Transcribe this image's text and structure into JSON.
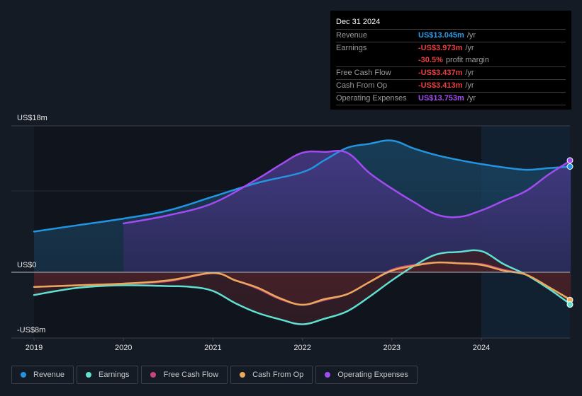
{
  "tooltip": {
    "date": "Dec 31 2024",
    "rows": [
      {
        "label": "Revenue",
        "value": "US$13.045m",
        "unit": "/yr",
        "color": "#2d9be8"
      },
      {
        "label": "Earnings",
        "value": "-US$3.973m",
        "unit": "/yr",
        "color": "#e84040"
      },
      {
        "label": "",
        "value": "-30.5%",
        "unit": "profit margin",
        "color": "#e84040"
      },
      {
        "label": "Free Cash Flow",
        "value": "-US$3.437m",
        "unit": "/yr",
        "color": "#e84040"
      },
      {
        "label": "Cash From Op",
        "value": "-US$3.413m",
        "unit": "/yr",
        "color": "#e84040"
      },
      {
        "label": "Operating Expenses",
        "value": "US$13.753m",
        "unit": "/yr",
        "color": "#a34ff0"
      }
    ]
  },
  "legend": [
    {
      "label": "Revenue",
      "color": "#2394e0"
    },
    {
      "label": "Earnings",
      "color": "#5fe0d0"
    },
    {
      "label": "Free Cash Flow",
      "color": "#c8467e"
    },
    {
      "label": "Cash From Op",
      "color": "#e8a95a"
    },
    {
      "label": "Operating Expenses",
      "color": "#a14cf0"
    }
  ],
  "chart_data": {
    "type": "area",
    "title": "",
    "xlabel": "",
    "ylabel": "",
    "ylim": [
      -8,
      18
    ],
    "y_tick_labels": [
      "US$18m",
      "US$0",
      "-US$8m"
    ],
    "x_tick_labels": [
      "2019",
      "2020",
      "2021",
      "2022",
      "2023",
      "2024"
    ],
    "xlim": [
      2019.0,
      2025.0
    ],
    "highlight_start": 2024.0,
    "series": [
      {
        "name": "Revenue",
        "color": "#2394e0",
        "x": [
          2019.0,
          2019.5,
          2020.0,
          2020.5,
          2021.0,
          2021.5,
          2022.0,
          2022.25,
          2022.5,
          2022.75,
          2023.0,
          2023.25,
          2023.5,
          2023.75,
          2024.0,
          2024.25,
          2024.5,
          2024.75,
          2025.0
        ],
        "values": [
          5.0,
          5.8,
          6.6,
          7.6,
          9.3,
          11.0,
          12.3,
          13.8,
          15.3,
          15.8,
          16.2,
          15.2,
          14.4,
          13.8,
          13.3,
          12.9,
          12.6,
          12.8,
          13.0
        ]
      },
      {
        "name": "Earnings",
        "color": "#5fe0d0",
        "x": [
          2019.0,
          2019.5,
          2020.0,
          2020.5,
          2020.75,
          2021.0,
          2021.25,
          2021.5,
          2021.75,
          2022.0,
          2022.25,
          2022.5,
          2022.75,
          2023.0,
          2023.25,
          2023.5,
          2023.75,
          2024.0,
          2024.25,
          2024.5,
          2024.75,
          2025.0
        ],
        "values": [
          -2.8,
          -1.9,
          -1.6,
          -1.7,
          -1.8,
          -2.3,
          -3.8,
          -5.0,
          -5.8,
          -6.4,
          -5.7,
          -4.8,
          -3.0,
          -1.0,
          0.8,
          2.2,
          2.5,
          2.6,
          1.0,
          -0.3,
          -2.0,
          -3.97
        ]
      },
      {
        "name": "Free Cash Flow",
        "color": "#c8467e",
        "x": [
          2019.0,
          2019.5,
          2020.0,
          2020.5,
          2021.0,
          2021.25,
          2021.5,
          2021.75,
          2022.0,
          2022.25,
          2022.5,
          2022.75,
          2023.0,
          2023.25,
          2023.5,
          2023.75,
          2024.0,
          2024.25,
          2024.5,
          2024.75,
          2025.0
        ],
        "values": [
          -1.8,
          -1.6,
          -1.4,
          -1.1,
          -0.1,
          -1.0,
          -2.0,
          -3.3,
          -4.0,
          -3.4,
          -2.7,
          -1.2,
          0.3,
          0.9,
          1.2,
          1.1,
          1.0,
          0.3,
          -0.3,
          -1.8,
          -3.44
        ]
      },
      {
        "name": "Cash From Op",
        "color": "#e8a95a",
        "x": [
          2019.0,
          2019.5,
          2020.0,
          2020.5,
          2021.0,
          2021.25,
          2021.5,
          2021.75,
          2022.0,
          2022.25,
          2022.5,
          2022.75,
          2023.0,
          2023.25,
          2023.5,
          2023.75,
          2024.0,
          2024.25,
          2024.5,
          2024.75,
          2025.0
        ],
        "values": [
          -1.8,
          -1.6,
          -1.4,
          -1.0,
          -0.1,
          -1.0,
          -1.9,
          -3.2,
          -4.0,
          -3.3,
          -2.7,
          -1.2,
          0.2,
          0.8,
          1.2,
          1.1,
          0.9,
          0.2,
          -0.3,
          -1.8,
          -3.41
        ]
      },
      {
        "name": "Operating Expenses",
        "color": "#a14cf0",
        "x": [
          2020.0,
          2020.5,
          2021.0,
          2021.5,
          2021.75,
          2022.0,
          2022.25,
          2022.5,
          2022.75,
          2023.0,
          2023.25,
          2023.5,
          2023.75,
          2024.0,
          2024.25,
          2024.5,
          2024.75,
          2025.0
        ],
        "values": [
          6.0,
          7.0,
          8.5,
          11.5,
          13.2,
          14.7,
          14.8,
          14.7,
          12.2,
          10.3,
          8.6,
          7.1,
          6.8,
          7.6,
          8.8,
          10.0,
          12.0,
          13.75
        ]
      }
    ],
    "grid": true,
    "legend_position": "bottom-left"
  }
}
